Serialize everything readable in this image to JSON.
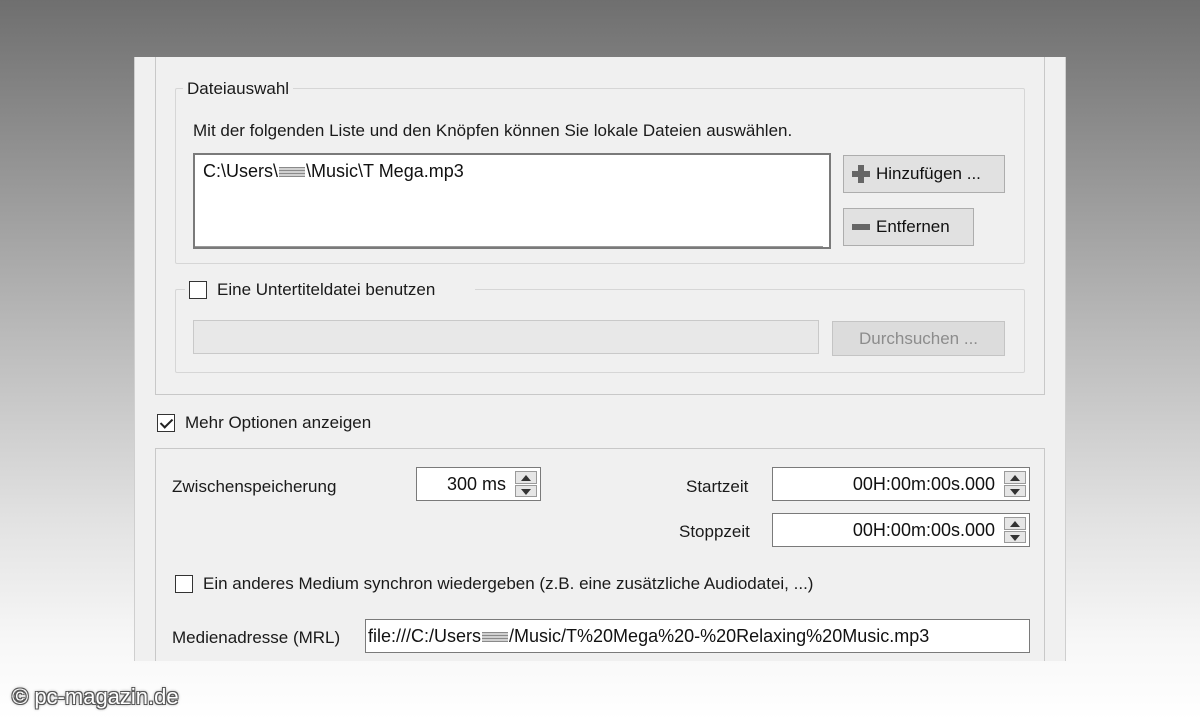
{
  "file_selection": {
    "legend": "Dateiauswahl",
    "description": "Mit der folgenden Liste und den Knöpfen können Sie lokale Dateien auswählen.",
    "files": [
      {
        "prefix": "C:\\Users\\",
        "suffix": "\\Music\\T Mega.mp3"
      }
    ],
    "add_button": "Hinzufügen ...",
    "remove_button": "Entfernen"
  },
  "subtitle": {
    "checkbox_label": "Eine Untertiteldatei benutzen",
    "checked": false,
    "path_value": "",
    "browse_button": "Durchsuchen ..."
  },
  "more_options": {
    "checkbox_label": "Mehr Optionen anzeigen",
    "checked": true
  },
  "options": {
    "caching_label": "Zwischenspeicherung",
    "caching_value": "300 ms",
    "start_label": "Startzeit",
    "start_value": "00H:00m:00s.000",
    "stop_label": "Stoppzeit",
    "stop_value": "00H:00m:00s.000",
    "sync_checkbox_label": "Ein anderes Medium synchron wiedergeben (z.B. eine zusätzliche Audiodatei, ...)",
    "sync_checked": false,
    "mrl_label": "Medienadresse (MRL)",
    "mrl_prefix": "file:///C:/Users",
    "mrl_suffix": "/Music/T%20Mega%20-%20Relaxing%20Music.mp3"
  },
  "watermark": "© pc-magazin.de",
  "colors": {
    "dialog_bg": "#f0f0f0",
    "button_bg": "#e1e1e1",
    "watermark_text": "#ffffff"
  }
}
